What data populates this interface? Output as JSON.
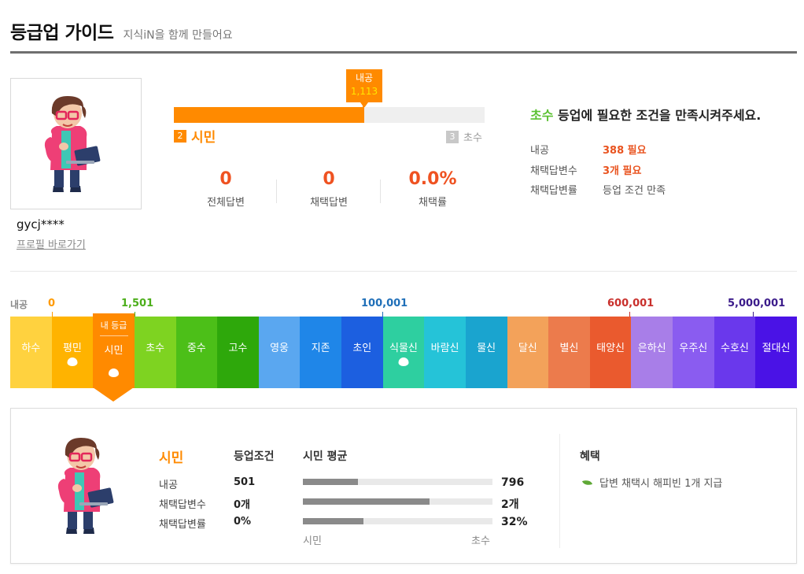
{
  "header": {
    "title": "등급업 가이드",
    "subtitle": "지식iN을 함께 만들어요"
  },
  "profile": {
    "username": "gycj****",
    "profile_link": "프로필 바로가기",
    "avatar_icon": "character-avatar-icon"
  },
  "progress": {
    "flag_label": "내공",
    "flag_value": "1,113",
    "fill_fraction": 0.61,
    "current_grade_num": "2",
    "current_grade": "시민",
    "next_grade_num": "3",
    "next_grade": "초수"
  },
  "stats": [
    {
      "value": "0",
      "label": "전체답변"
    },
    {
      "value": "0",
      "label": "채택답변"
    },
    {
      "value": "0.0%",
      "label": "채택률"
    }
  ],
  "requirements": {
    "title_grade": "초수",
    "title_rest": " 등업에 필요한 조건을 만족시켜주세요.",
    "rows": [
      {
        "key": "내공",
        "value": "388 필요"
      },
      {
        "key": "채택답변수",
        "value": "3개 필요"
      },
      {
        "key": "채택답변률",
        "value": "등업 조건 만족"
      }
    ]
  },
  "scale": {
    "axis_label": "내공",
    "marks": [
      {
        "label": "0",
        "color": "#ff9a00"
      },
      {
        "label": "1,501",
        "color": "#4cae1a"
      },
      {
        "label": "100,001",
        "color": "#1f6fb8"
      },
      {
        "label": "600,001",
        "color": "#c9302c"
      },
      {
        "label": "5,000,001",
        "color": "#3b1b8a"
      }
    ]
  },
  "grades": [
    {
      "name": "하수",
      "color": "#ffd23f",
      "egg": false
    },
    {
      "name": "평민",
      "color": "#ffb300",
      "egg": true
    },
    {
      "name": "시민",
      "color": "#ff8a00",
      "egg": true,
      "current": true
    },
    {
      "name": "초수",
      "color": "#7ed321",
      "egg": false
    },
    {
      "name": "중수",
      "color": "#4cbf18",
      "egg": false
    },
    {
      "name": "고수",
      "color": "#2ea80b",
      "egg": false
    },
    {
      "name": "영웅",
      "color": "#5aa7f0",
      "egg": false
    },
    {
      "name": "지존",
      "color": "#1f86e8",
      "egg": false
    },
    {
      "name": "초인",
      "color": "#1c5fe0",
      "egg": false
    },
    {
      "name": "식물신",
      "color": "#2ecfa0",
      "egg": true
    },
    {
      "name": "바람신",
      "color": "#25c3d8",
      "egg": false
    },
    {
      "name": "물신",
      "color": "#1aa4cf",
      "egg": false
    },
    {
      "name": "달신",
      "color": "#f3a25a",
      "egg": false
    },
    {
      "name": "별신",
      "color": "#ec7b4c",
      "egg": false
    },
    {
      "name": "태양신",
      "color": "#ea5a2e",
      "egg": false
    },
    {
      "name": "은하신",
      "color": "#a87ee8",
      "egg": false
    },
    {
      "name": "우주신",
      "color": "#8a5cf0",
      "egg": false
    },
    {
      "name": "수호신",
      "color": "#6a38ec",
      "egg": false
    },
    {
      "name": "절대신",
      "color": "#4a12e6",
      "egg": false
    }
  ],
  "current_marker": {
    "my_grade_label": "내 등급",
    "grade": "시민"
  },
  "detail": {
    "grade_name": "시민",
    "col_condition": "등업조건",
    "col_average": "시민 평균",
    "rows": [
      {
        "key": "내공",
        "condition": "501",
        "avg": "796",
        "avg_fraction": 0.29
      },
      {
        "key": "채택답변수",
        "condition": "0개",
        "avg": "2개",
        "avg_fraction": 0.67
      },
      {
        "key": "채택답변률",
        "condition": "0%",
        "avg": "32%",
        "avg_fraction": 0.32
      }
    ],
    "bar_left_label": "시민",
    "bar_right_label": "초수",
    "benefit_title": "혜택",
    "benefit_text": "답변 채택시 해피빈 1개 지급"
  }
}
